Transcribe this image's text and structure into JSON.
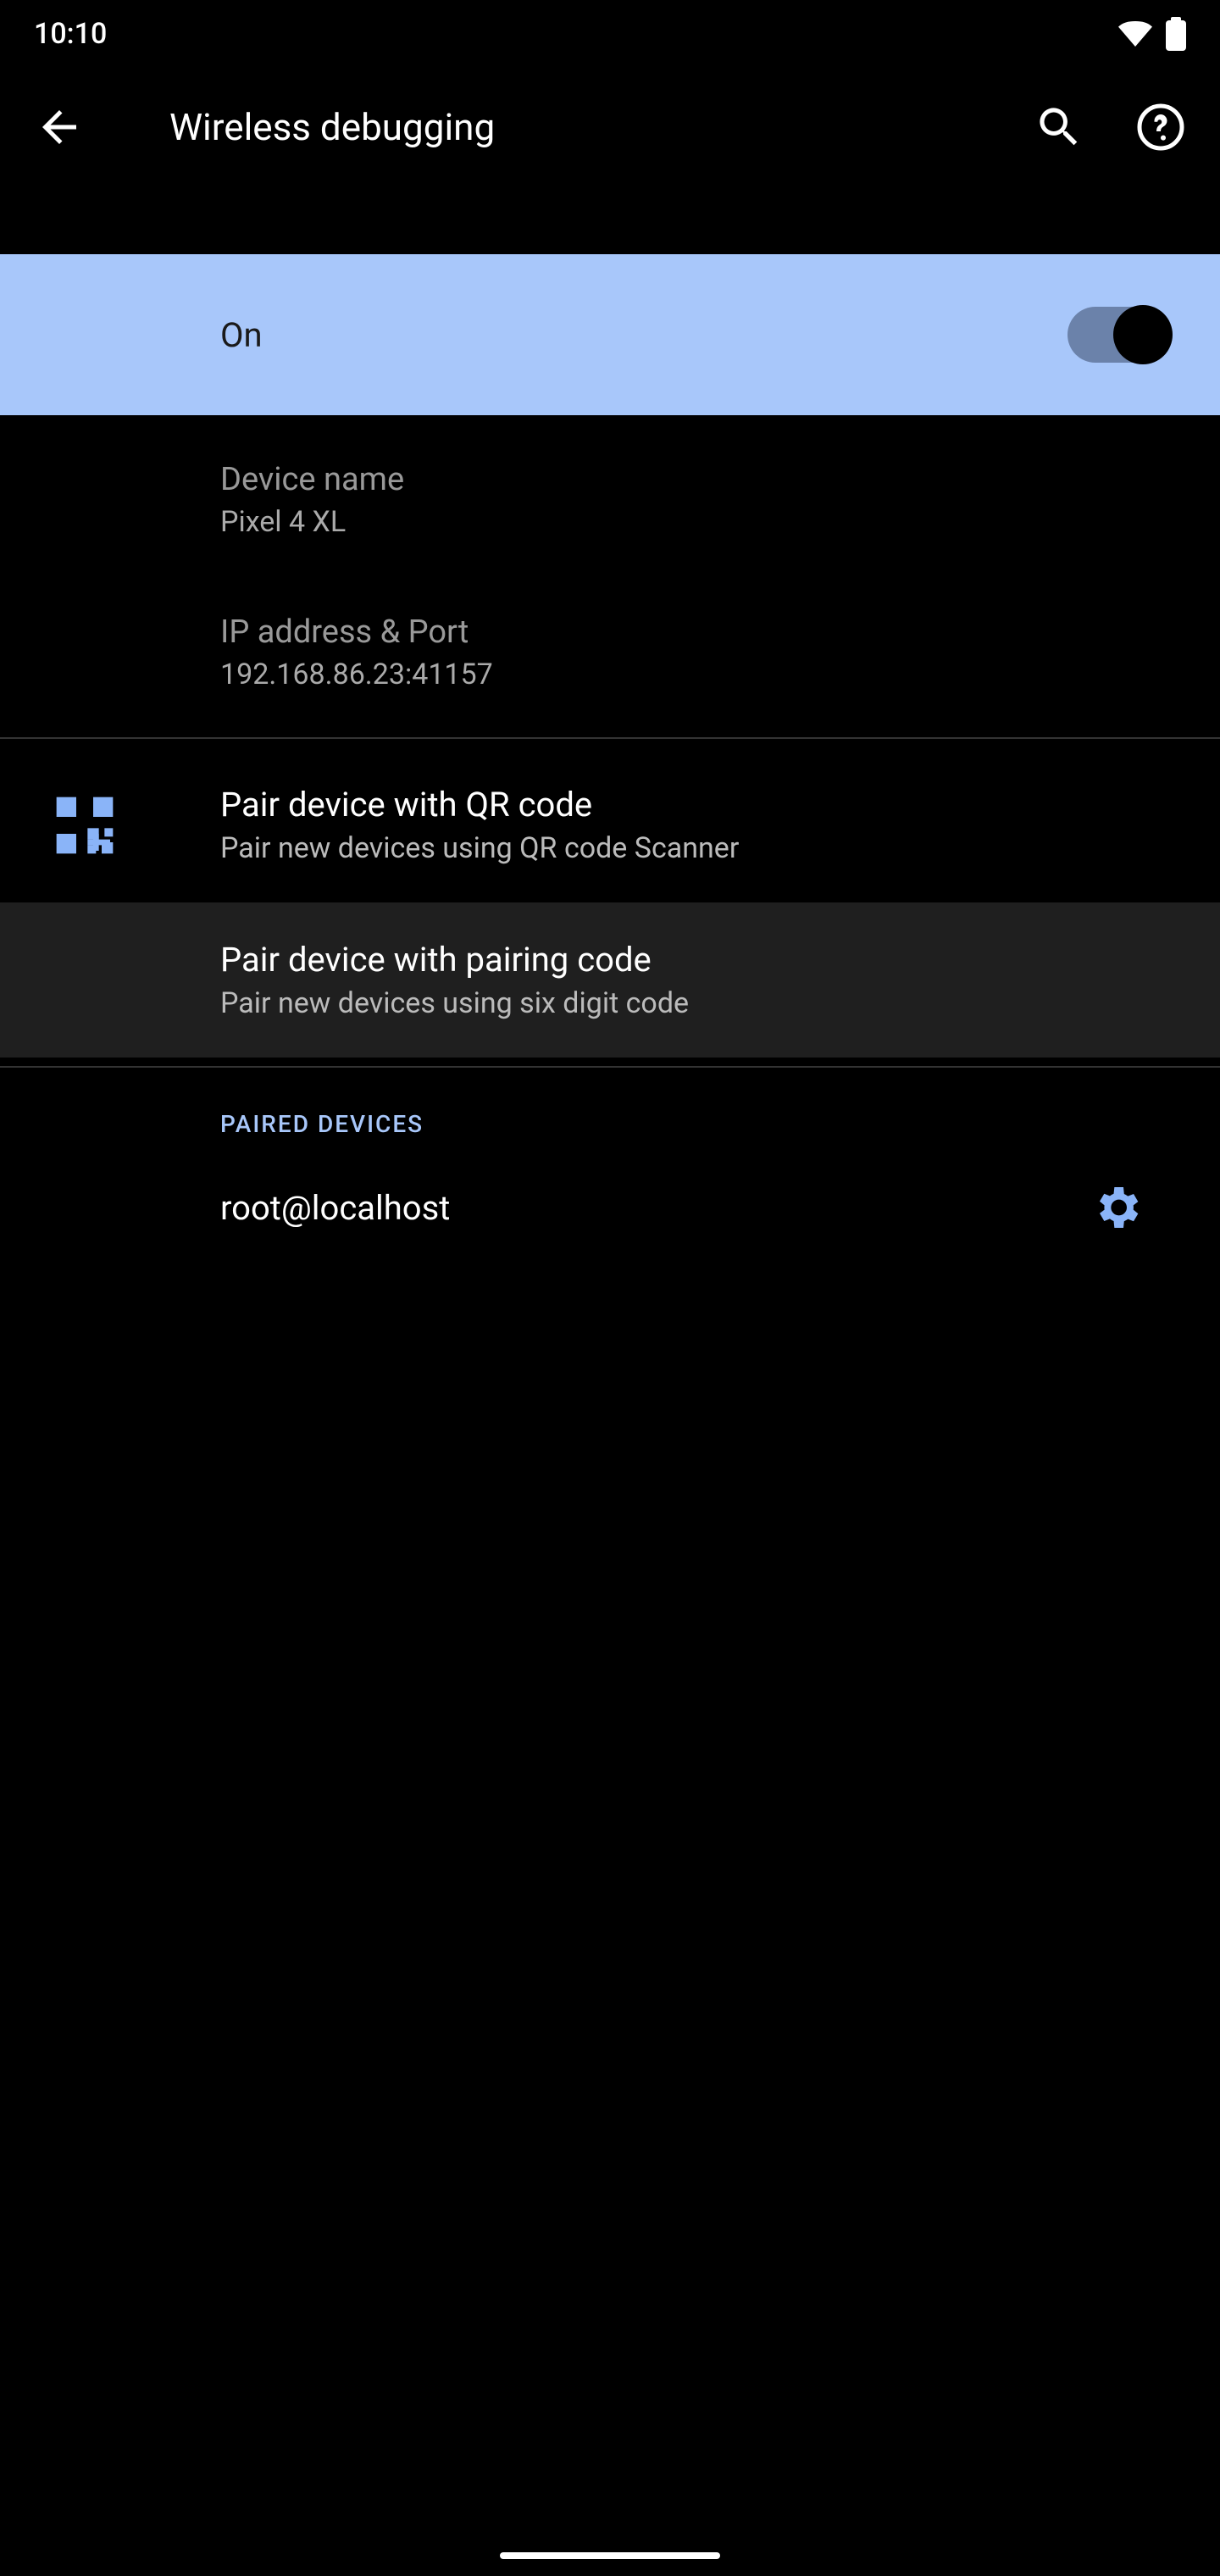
{
  "status": {
    "time": "10:10"
  },
  "header": {
    "title": "Wireless debugging"
  },
  "toggle": {
    "label": "On",
    "state": true
  },
  "device_name": {
    "label": "Device name",
    "value": "Pixel 4 XL"
  },
  "ip_port": {
    "label": "IP address & Port",
    "value": "192.168.86.23:41157"
  },
  "pair_qr": {
    "title": "Pair device with QR code",
    "sub": "Pair new devices using QR code Scanner"
  },
  "pair_code": {
    "title": "Pair device with pairing code",
    "sub": "Pair new devices using six digit code"
  },
  "paired_section": {
    "header": "PAIRED DEVICES"
  },
  "paired_devices": [
    {
      "name": "root@localhost"
    }
  ],
  "colors": {
    "accent": "#a8c7fa"
  }
}
